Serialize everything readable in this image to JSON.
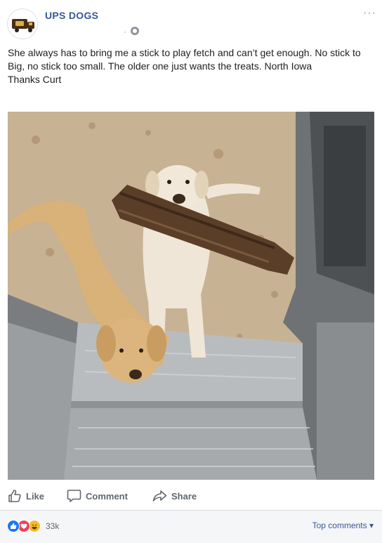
{
  "post": {
    "page_name": "UPS DOGS",
    "more_label": "···",
    "meta_dot": "·",
    "text": "She always has to bring me a stick to play fetch and can’t get enough. No stick to Big, no stick too small. The older one just wants the treats. North Iowa\nThanks Curt"
  },
  "actions": {
    "like": "Like",
    "comment": "Comment",
    "share": "Share"
  },
  "footer": {
    "reaction_count": "33k",
    "top_comments": "Top comments ▾"
  },
  "colors": {
    "accent": "#365899",
    "like_blue": "#1877f2",
    "love_red": "#f33e58",
    "haha_yellow": "#f7b928"
  },
  "icons": [
    "truck-logo-icon",
    "globe-icon",
    "more-icon",
    "like-icon",
    "comment-icon",
    "share-icon",
    "like-reaction-icon",
    "love-reaction-icon",
    "haha-reaction-icon"
  ]
}
